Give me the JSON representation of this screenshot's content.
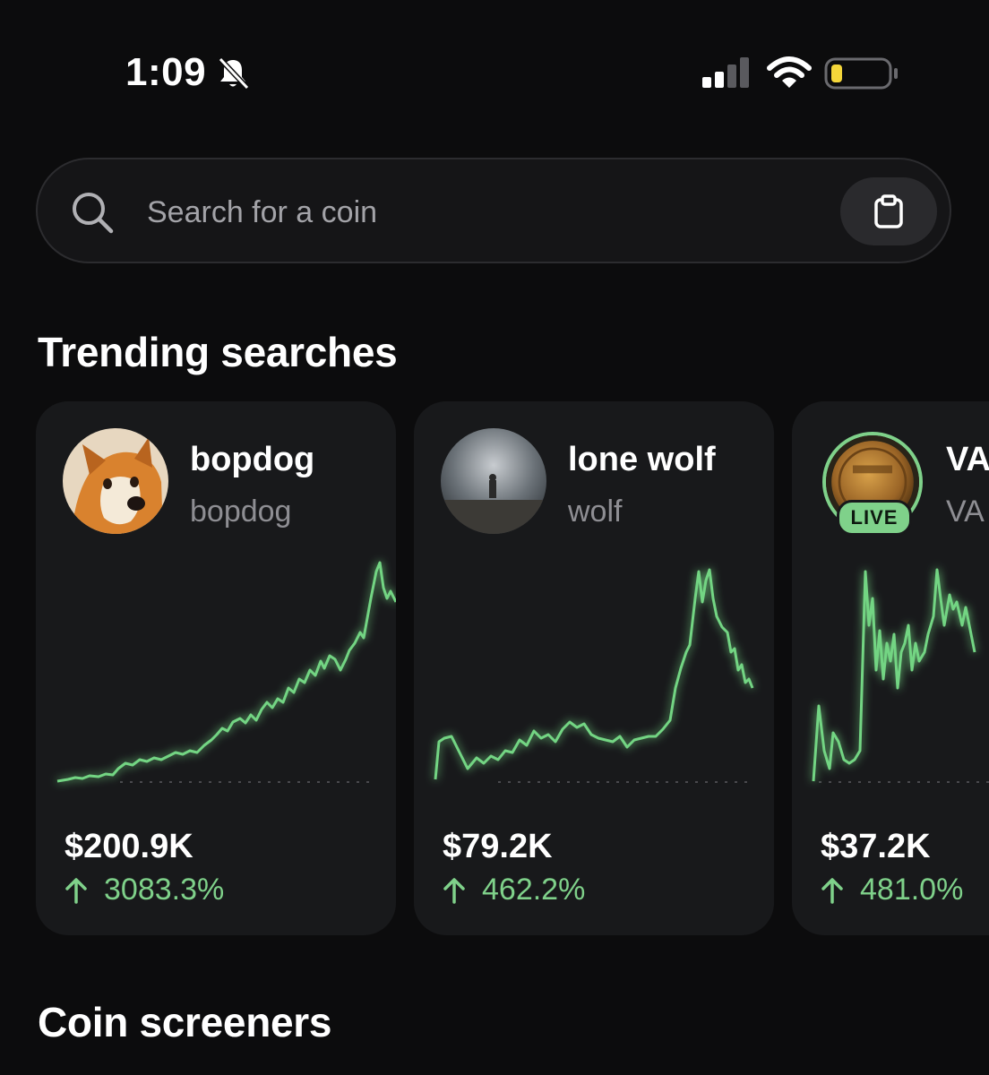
{
  "status_bar": {
    "time": "1:09"
  },
  "search": {
    "placeholder": "Search for a coin"
  },
  "trending": {
    "title": "Trending searches",
    "items": [
      {
        "name": "bopdog",
        "ticker": "bopdog",
        "price": "$200.9K",
        "change": "3083.3%",
        "live": false
      },
      {
        "name": "lone wolf",
        "ticker": "wolf",
        "price": "$79.2K",
        "change": "462.2%",
        "live": false
      },
      {
        "name": "VA",
        "ticker": "VA",
        "price": "$37.2K",
        "change": "481.0%",
        "live": true,
        "live_label": "LIVE"
      }
    ]
  },
  "screeners": {
    "title": "Coin screeners"
  },
  "colors": {
    "accent_green": "#7fd18a",
    "card_bg": "#18191b"
  },
  "icons": [
    "bell-slash-icon",
    "signal-icon",
    "wifi-icon",
    "battery-icon",
    "search-icon",
    "clipboard-icon",
    "arrow-up-icon"
  ]
}
